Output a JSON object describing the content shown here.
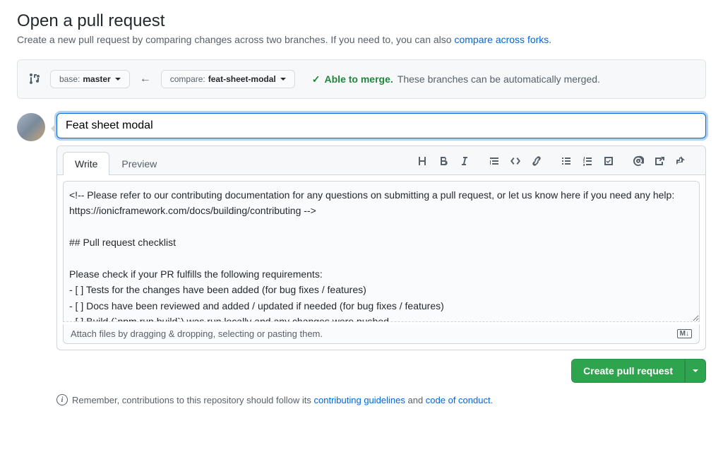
{
  "header": {
    "title": "Open a pull request",
    "subtitle_before": "Create a new pull request by comparing changes across two branches. If you need to, you can also ",
    "subtitle_link": "compare across forks",
    "subtitle_after": "."
  },
  "compare": {
    "base_label": "base:",
    "base_value": "master",
    "compare_label": "compare:",
    "compare_value": "feat-sheet-modal",
    "merge_able": "Able to merge.",
    "merge_desc": "These branches can be automatically merged."
  },
  "form": {
    "title_value": "Feat sheet modal",
    "tabs": {
      "write": "Write",
      "preview": "Preview"
    },
    "body_value": "<!-- Please refer to our contributing documentation for any questions on submitting a pull request, or let us know here if you need any help: https://ionicframework.com/docs/building/contributing -->\n\n## Pull request checklist\n\nPlease check if your PR fulfills the following requirements:\n- [ ] Tests for the changes have been added (for bug fixes / features)\n- [ ] Docs have been reviewed and added / updated if needed (for bug fixes / features)\n- [ ] Build (`npm run build`) was run locally and any changes were pushed",
    "attach_hint": "Attach files by dragging & dropping, selecting or pasting them.",
    "create_label": "Create pull request"
  },
  "footer": {
    "before": "Remember, contributions to this repository should follow its ",
    "link1": "contributing guidelines",
    "middle": " and ",
    "link2": "code of conduct",
    "after": "."
  }
}
